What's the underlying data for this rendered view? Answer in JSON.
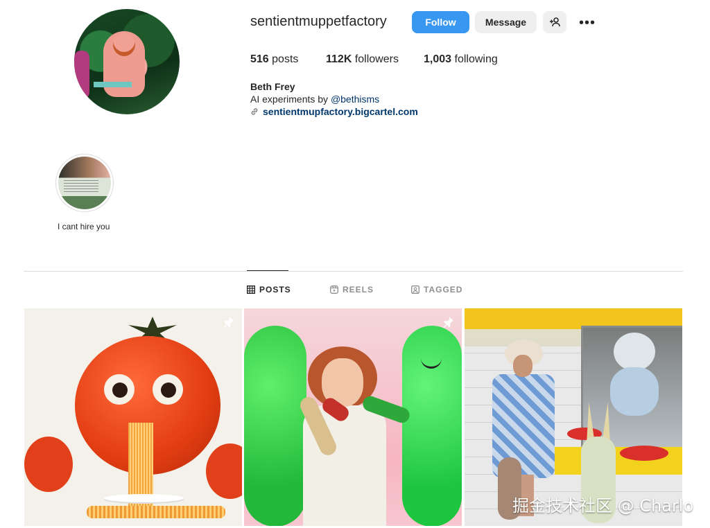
{
  "profile": {
    "username": "sentientmuppetfactory",
    "full_name": "Beth Frey",
    "bio_prefix": "AI experiments by ",
    "bio_mention": "@bethisms",
    "link": "sentientmupfactory.bigcartel.com"
  },
  "actions": {
    "follow": "Follow",
    "message": "Message",
    "more": "•••"
  },
  "stats": {
    "posts_count": "516",
    "posts_label": " posts",
    "followers_count": "112K",
    "followers_label": " followers",
    "following_count": "1,003",
    "following_label": " following"
  },
  "highlight": {
    "label": "I cant hire you"
  },
  "tabs": {
    "posts": "POSTS",
    "reels": "REELS",
    "tagged": "TAGGED",
    "active": "posts"
  },
  "posts": [
    {
      "pinned": true
    },
    {
      "pinned": true
    },
    {
      "pinned": false
    }
  ],
  "watermark": "掘金技术社区 @ Charlo",
  "colors": {
    "accent": "#3897f0",
    "link": "#00376b"
  }
}
